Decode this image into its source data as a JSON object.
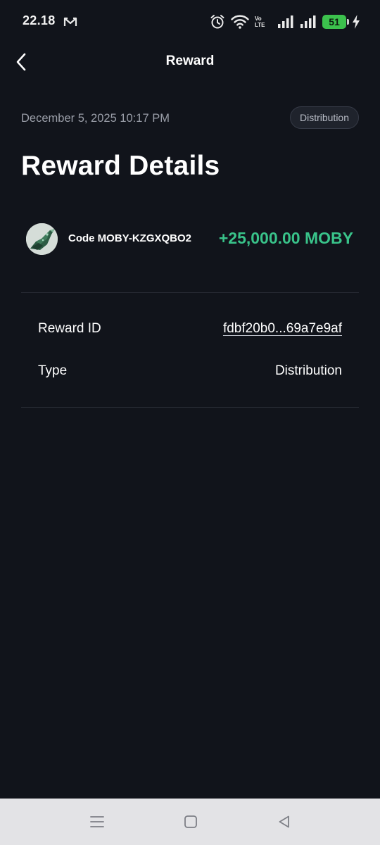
{
  "status_bar": {
    "time": "22.18",
    "volte_top": "Vo",
    "volte_bottom": "LTE",
    "battery": "51",
    "icons": [
      "mail-m-icon",
      "alarm-icon",
      "wifi-icon",
      "volte-icon",
      "signal-icon",
      "signal-icon",
      "battery-icon",
      "charging-icon"
    ]
  },
  "header": {
    "title": "Reward",
    "back_icon": "chevron-left-icon"
  },
  "meta": {
    "date": "December 5, 2025 10:17 PM",
    "badge": "Distribution"
  },
  "page_title": "Reward Details",
  "reward": {
    "code": "Code MOBY-KZGXQBO2",
    "amount": "+25,000.00 MOBY",
    "amount_color": "#39c38a",
    "avatar_icon": "moby-token-icon"
  },
  "details": [
    {
      "label": "Reward ID",
      "value": "fdbf20b0...69a7e9af"
    },
    {
      "label": "Type",
      "value": "Distribution"
    }
  ],
  "nav_bar": {
    "icons": [
      "menu-icon",
      "home-square-icon",
      "back-triangle-icon"
    ]
  },
  "colors": {
    "background": "#11141b",
    "accent_green": "#39c38a",
    "muted_text": "#9a9ea8"
  }
}
